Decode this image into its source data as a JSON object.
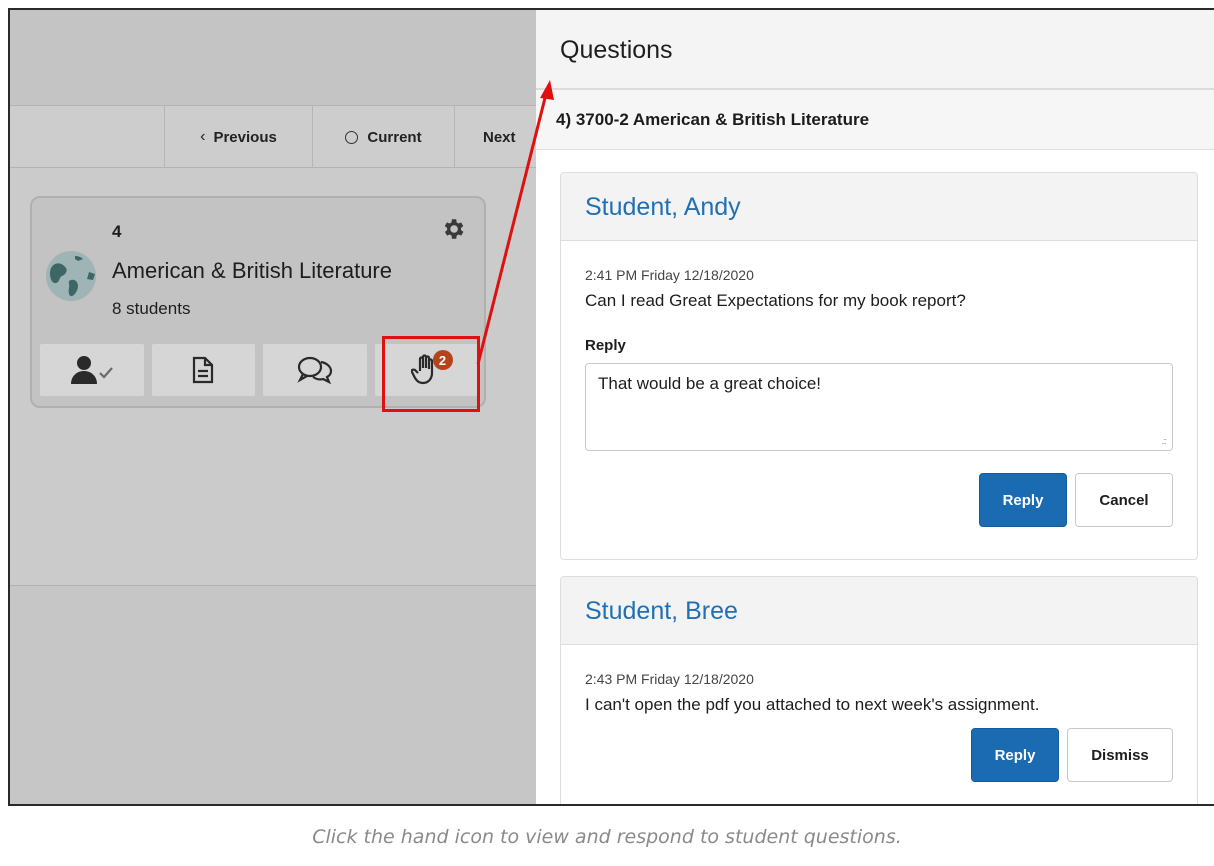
{
  "nav": {
    "previous_label": "Previous",
    "current_label": "Current",
    "next_label": "Next"
  },
  "course_card": {
    "period": "4",
    "title": "American & British Literature",
    "student_count": "8 students",
    "question_badge": "2",
    "tools": [
      "attendance-icon",
      "document-icon",
      "discussion-icon",
      "raised-hand-icon"
    ]
  },
  "panel": {
    "title": "Questions",
    "section_label": "4) 3700-2 American & British Literature",
    "questions": [
      {
        "student": "Student, Andy",
        "timestamp": "2:41 PM Friday 12/18/2020",
        "text": "Can I read Great Expectations for my book report?",
        "reply_label": "Reply",
        "reply_value": "That would be a great choice!",
        "primary_action": "Reply",
        "secondary_action": "Cancel"
      },
      {
        "student": "Student, Bree",
        "timestamp": "2:43 PM Friday 12/18/2020",
        "text": "I can't open the pdf you attached to next week's assignment.",
        "primary_action": "Reply",
        "secondary_action": "Dismiss"
      }
    ]
  },
  "caption": "Click the hand icon to view and respond to student questions.",
  "colors": {
    "accent": "#1b6bb3",
    "link": "#1f70b5",
    "badge": "#b5441c",
    "highlight": "#e01010"
  }
}
